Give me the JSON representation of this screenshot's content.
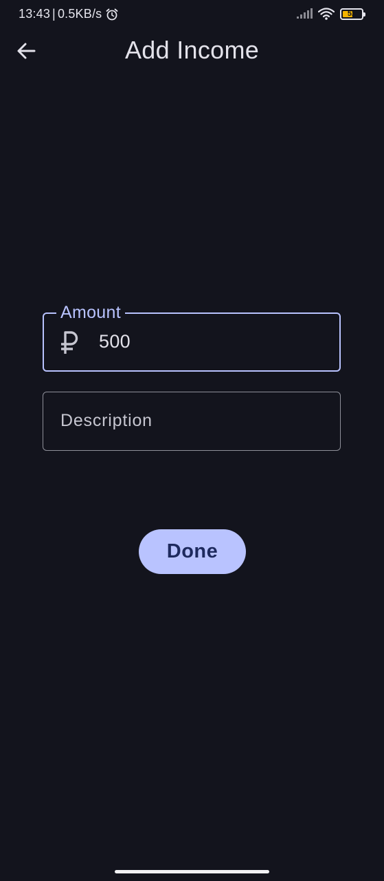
{
  "status_bar": {
    "time": "13:43",
    "separator": "|",
    "net_speed": "0.5KB/s",
    "battery_level": "52",
    "icons": [
      "alarm-icon",
      "signal-icon",
      "wifi-icon",
      "battery-icon"
    ]
  },
  "top_bar": {
    "title": "Add Income",
    "back_icon": "arrow-back-icon"
  },
  "form": {
    "amount": {
      "label": "Amount",
      "currency_icon": "ruble-icon",
      "value": "500"
    },
    "description": {
      "placeholder": "Description",
      "value": ""
    }
  },
  "actions": {
    "done_label": "Done"
  },
  "colors": {
    "background": "#13141d",
    "accent": "#b9c3ff",
    "on_accent": "#1e2a5e",
    "text": "#e3e2ea",
    "outline": "#8f909a"
  }
}
